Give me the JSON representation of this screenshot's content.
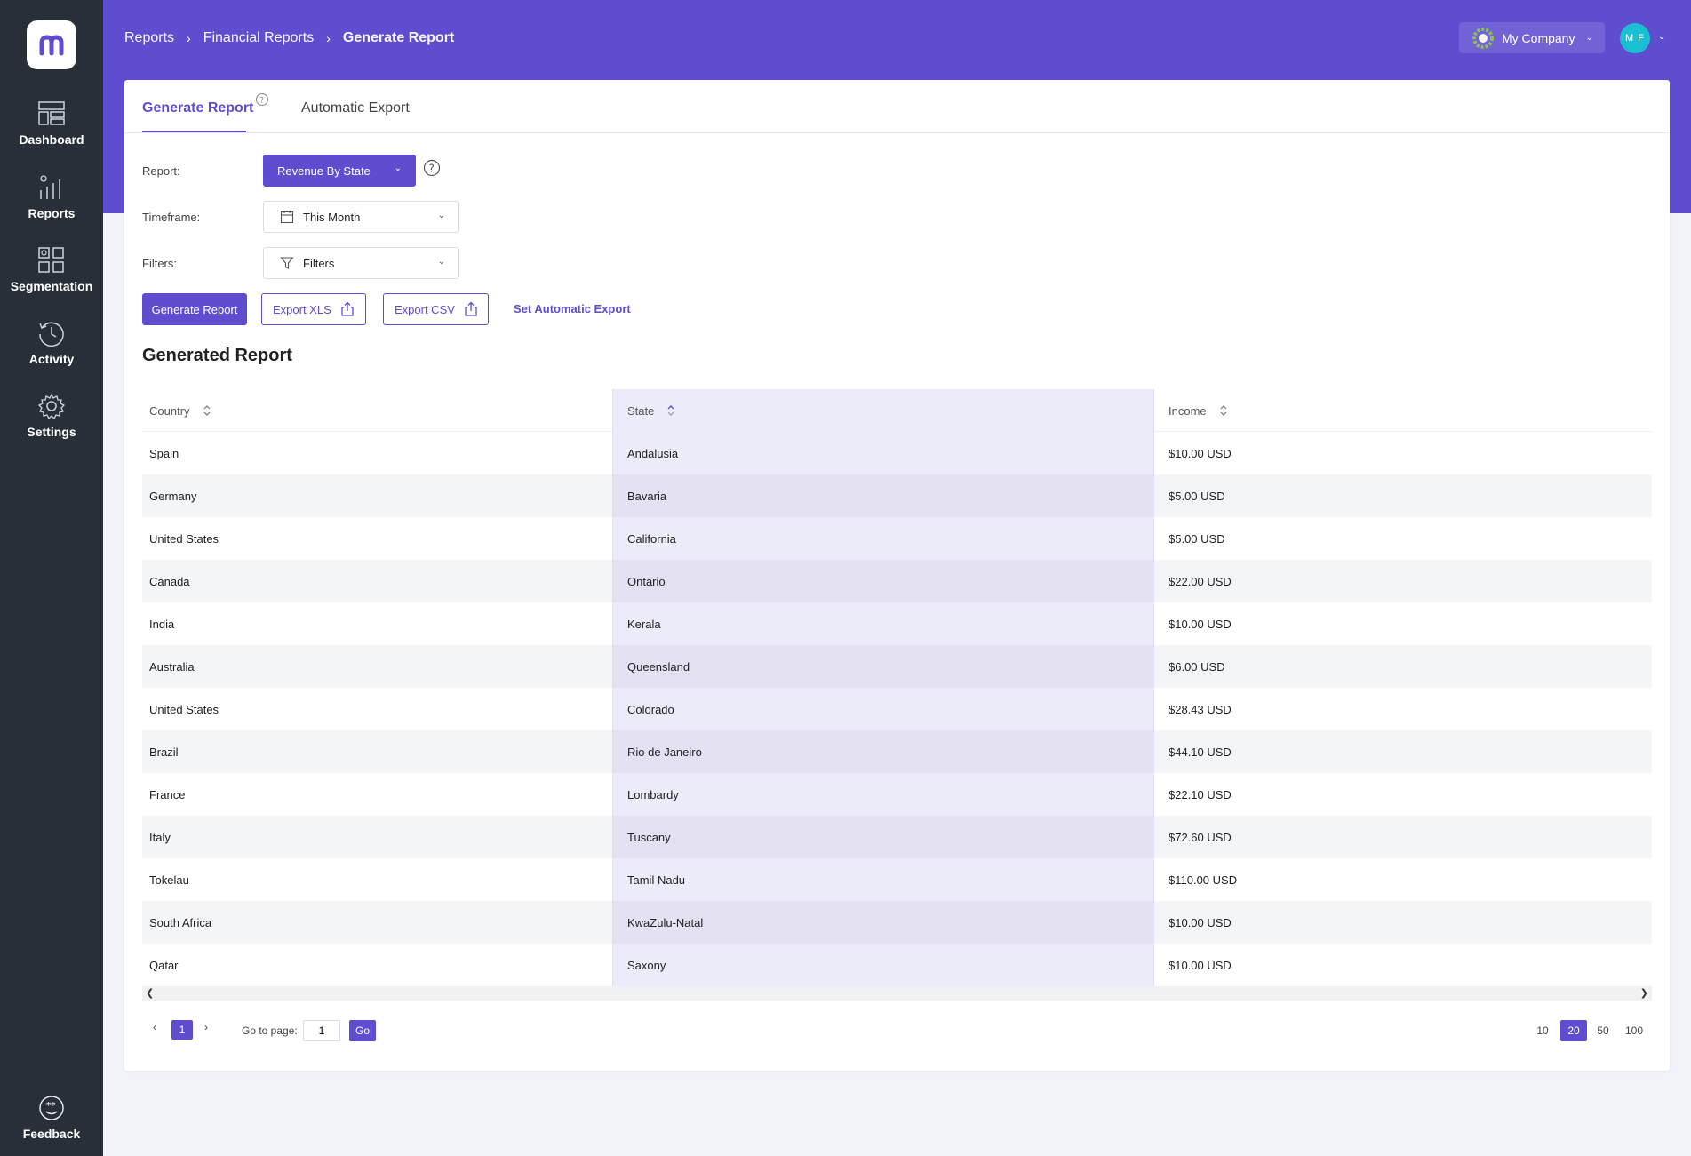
{
  "sidebar": {
    "items": [
      {
        "label": "Dashboard"
      },
      {
        "label": "Reports"
      },
      {
        "label": "Segmentation"
      },
      {
        "label": "Activity"
      },
      {
        "label": "Settings"
      }
    ],
    "feedback": "Feedback"
  },
  "header": {
    "breadcrumbs": [
      "Reports",
      "Financial Reports",
      "Generate Report"
    ],
    "company": "My Company",
    "avatar_initials": "M F"
  },
  "tabs": [
    "Generate Report",
    "Automatic Export"
  ],
  "form": {
    "report_label": "Report:",
    "report_value": "Revenue By State",
    "timeframe_label": "Timeframe:",
    "timeframe_value": "This Month",
    "filters_label": "Filters:",
    "filters_value": "Filters"
  },
  "actions": {
    "generate": "Generate Report",
    "export_xls": "Export XLS",
    "export_csv": "Export CSV",
    "set_auto_export": "Set Automatic Export"
  },
  "section_title": "Generated Report",
  "table": {
    "columns": [
      "Country",
      "State",
      "Income"
    ],
    "rows": [
      [
        "Spain",
        "Andalusia",
        "$10.00 USD"
      ],
      [
        "Germany",
        "Bavaria",
        "$5.00 USD"
      ],
      [
        "United States",
        "California",
        "$5.00 USD"
      ],
      [
        "Canada",
        "Ontario",
        "$22.00 USD"
      ],
      [
        "India",
        "Kerala",
        "$10.00 USD"
      ],
      [
        "Australia",
        "Queensland",
        "$6.00 USD"
      ],
      [
        "United States",
        "Colorado",
        "$28.43 USD"
      ],
      [
        "Brazil",
        "Rio de Janeiro",
        "$44.10 USD"
      ],
      [
        "France",
        "Lombardy",
        "$22.10 USD"
      ],
      [
        "Italy",
        "Tuscany",
        "$72.60 USD"
      ],
      [
        "Tokelau",
        "Tamil Nadu",
        "$110.00 USD"
      ],
      [
        "South Africa",
        "KwaZulu-Natal",
        "$10.00 USD"
      ],
      [
        "Qatar",
        "Saxony",
        "$10.00 USD"
      ]
    ]
  },
  "pagination": {
    "current_page": "1",
    "goto_label": "Go to page:",
    "goto_value": "1",
    "go_label": "Go",
    "page_sizes": [
      "10",
      "20",
      "50",
      "100"
    ],
    "active_size": "20"
  },
  "colors": {
    "accent": "#5e4ecf",
    "sidebar": "#292f38",
    "avatar": "#18c0d2"
  }
}
